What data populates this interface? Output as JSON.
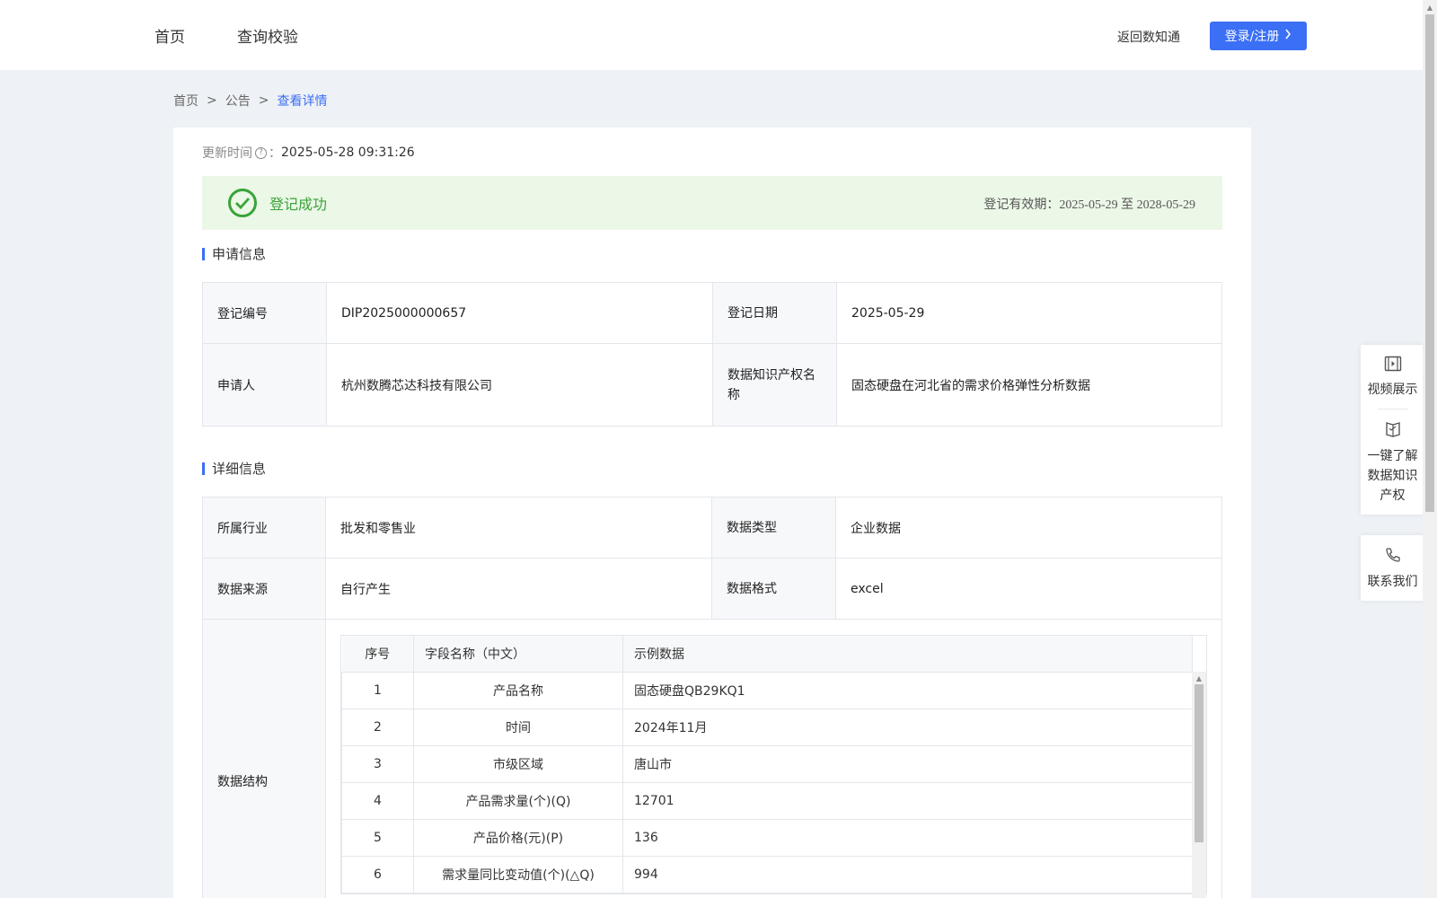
{
  "nav": {
    "home": "首页",
    "query": "查询校验",
    "return": "返回数知通",
    "login": "登录/注册",
    "login_icon": "chevron-right-icon"
  },
  "breadcrumb": {
    "items": [
      "首页",
      "公告",
      "查看详情"
    ],
    "separator": ">"
  },
  "update": {
    "label": "更新时间",
    "colon": "：",
    "value": "2025-05-28 09:31:26"
  },
  "status": {
    "text": "登记成功",
    "validity_label": "登记有效期：",
    "validity_value": "2025-05-29 至 2028-05-29",
    "color": "#3aa33a"
  },
  "apply_section": {
    "title": "申请信息",
    "reg_no_label": "登记编号",
    "reg_no": "DIP2025000000657",
    "reg_date_label": "登记日期",
    "reg_date": "2025-05-29",
    "applicant_label": "申请人",
    "applicant": "杭州数腾芯达科技有限公司",
    "name_label": "数据知识产权名称",
    "name": "固态硬盘在河北省的需求价格弹性分析数据"
  },
  "detail_section": {
    "title": "详细信息",
    "industry_label": "所属行业",
    "industry": "批发和零售业",
    "type_label": "数据类型",
    "type": "企业数据",
    "source_label": "数据来源",
    "source": "自行产生",
    "format_label": "数据格式",
    "format": "excel",
    "structure_label": "数据结构"
  },
  "structure_table": {
    "headers": [
      "序号",
      "字段名称（中文）",
      "示例数据"
    ],
    "rows": [
      [
        "1",
        "产品名称",
        "固态硬盘QB29KQ1"
      ],
      [
        "2",
        "时间",
        "2024年11月"
      ],
      [
        "3",
        "市级区域",
        "唐山市"
      ],
      [
        "4",
        "产品需求量(个)(Q)",
        "12701"
      ],
      [
        "5",
        "产品价格(元)(P)",
        "136"
      ],
      [
        "6",
        "需求量同比变动值(个)(△Q)",
        "994"
      ]
    ]
  },
  "side_panel": {
    "video": "视频展示",
    "learn": "一键了解数据知识产权",
    "contact": "联系我们"
  },
  "colors": {
    "accent": "#3b6ff5",
    "success_bg": "#ebf7e7",
    "page_bg": "#eef1f5"
  }
}
